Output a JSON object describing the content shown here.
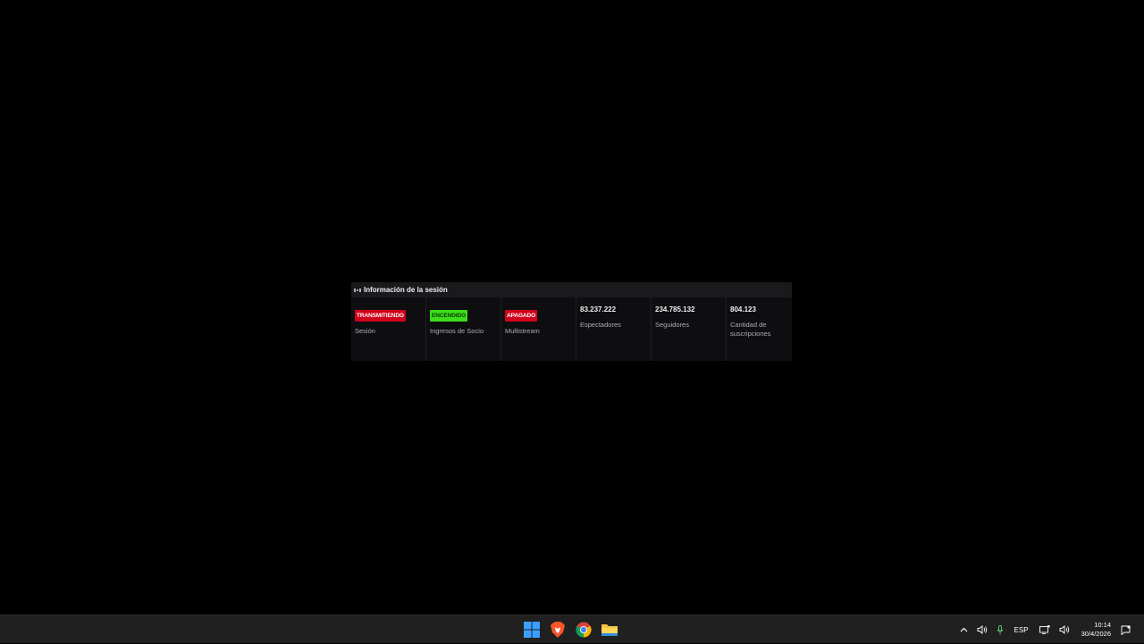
{
  "panel": {
    "title": "Información de la sesión",
    "icon": "broadcast-icon",
    "stats": [
      {
        "badge": "TRANSMITIENDO",
        "badge_color": "#d0021b",
        "label": "Sesión"
      },
      {
        "badge": "ENCENDIDO",
        "badge_color": "#3bde1a",
        "label": "Ingresos de Socio"
      },
      {
        "badge": "APAGADO",
        "badge_color": "#d0021b",
        "label": "Multistream"
      },
      {
        "value": "83.237.222",
        "label": "Espectadores"
      },
      {
        "value": "234.785.132",
        "label": "Seguidores"
      },
      {
        "value": "804.123",
        "label": "Cantidad de suscripciones"
      }
    ]
  },
  "taskbar": {
    "apps": [
      "windows-start-icon",
      "brave-browser-icon",
      "chrome-icon",
      "file-explorer-icon"
    ],
    "tray": {
      "language": "ESP",
      "time": "10:14",
      "date": "30/4/2026"
    }
  }
}
